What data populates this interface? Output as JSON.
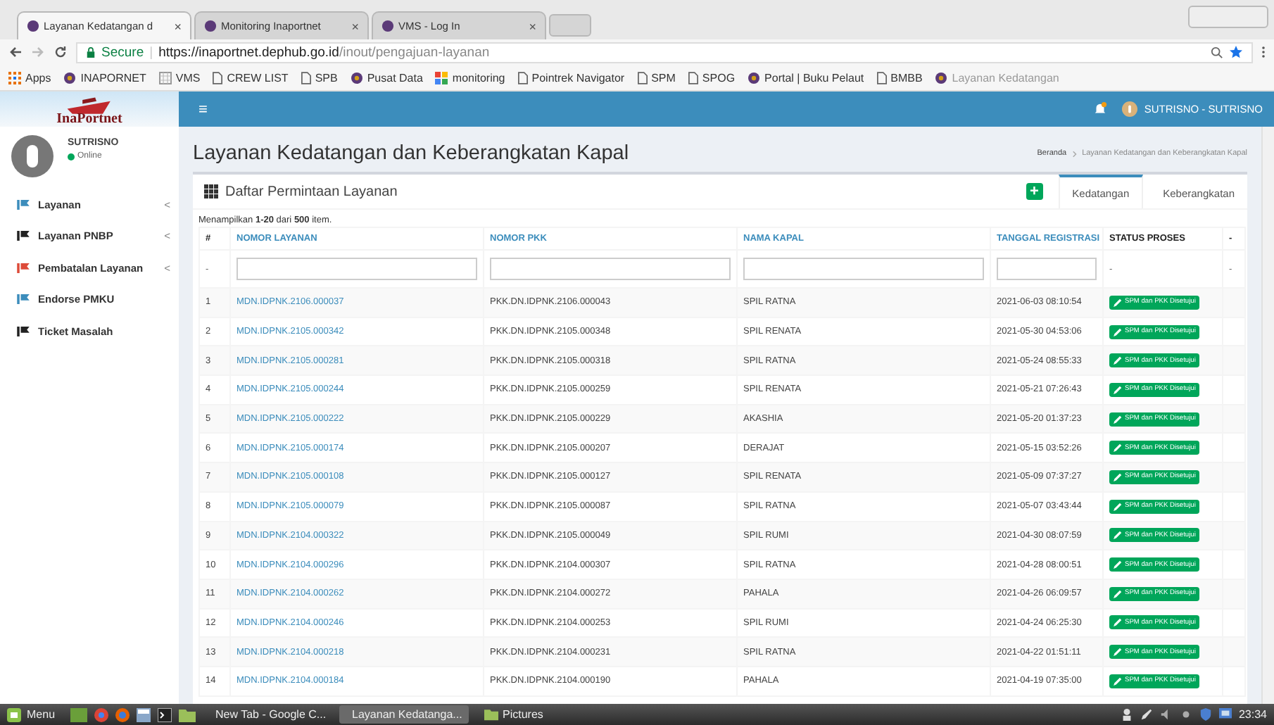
{
  "browser": {
    "tabs": [
      {
        "title": "Layanan Kedatangan d",
        "selected": true,
        "close": "×"
      },
      {
        "title": "Monitoring Inaportnet",
        "selected": false,
        "close": "×"
      },
      {
        "title": "VMS - Log In",
        "selected": false,
        "close": "×"
      }
    ],
    "secure_label": "Secure",
    "separator": "|",
    "url_host": "https://inaportnet.dephub.go.id",
    "url_path": "/inout/pengajuan-layanan",
    "bookmarks": [
      {
        "label": "Apps",
        "kind": "apps"
      },
      {
        "label": "INAPORNET",
        "kind": "site"
      },
      {
        "label": "VMS",
        "kind": "grid"
      },
      {
        "label": "CREW LIST",
        "kind": "page"
      },
      {
        "label": "SPB",
        "kind": "page"
      },
      {
        "label": "Pusat Data",
        "kind": "site"
      },
      {
        "label": "monitoring",
        "kind": "tiles"
      },
      {
        "label": "Pointrek Navigator",
        "kind": "page"
      },
      {
        "label": "SPM",
        "kind": "page"
      },
      {
        "label": "SPOG",
        "kind": "page"
      },
      {
        "label": "Portal | Buku Pelaut",
        "kind": "site"
      },
      {
        "label": "BMBB",
        "kind": "page"
      },
      {
        "label": "Layanan Kedatangan",
        "kind": "site"
      }
    ]
  },
  "header": {
    "logo": "InaPortnet",
    "menu": "≡",
    "user": "SUTRISNO - SUTRISNO"
  },
  "sidebar": {
    "user": {
      "name": "SUTRISNO",
      "status": "Online"
    },
    "items": [
      {
        "label": "Layanan",
        "color": "#3c8dbc",
        "arrow": "<"
      },
      {
        "label": "Layanan PNBP",
        "color": "#222222",
        "arrow": "<"
      },
      {
        "label": "Pembatalan Layanan",
        "color": "#dd4b39",
        "arrow": "<"
      },
      {
        "label": "Endorse PMKU",
        "color": "#3c8dbc"
      },
      {
        "label": "Ticket Masalah",
        "color": "#222222"
      }
    ]
  },
  "page": {
    "title": "Layanan Kedatangan dan Keberangkatan Kapal",
    "breadcrumb": [
      "Beranda",
      "Layanan Kedatangan dan Keberangkatan Kapal"
    ]
  },
  "box": {
    "title": "Daftar Permintaan Layanan",
    "add": "+",
    "tabs": [
      {
        "label": "Kedatangan",
        "selected": true
      },
      {
        "label": "Keberangkatan",
        "selected": false
      }
    ],
    "summary": "Menampilkan **1-20** dari **500** item."
  },
  "table": {
    "columns": [
      {
        "label": "#",
        "sortable": false
      },
      {
        "label": "NOMOR LAYANAN",
        "sortable": true
      },
      {
        "label": "NOMOR PKK",
        "sortable": true
      },
      {
        "label": "NAMA KAPAL",
        "sortable": true
      },
      {
        "label": "TANGGAL REGISTRASI",
        "sortable": true
      },
      {
        "label": "STATUS PROSES",
        "sortable": false
      },
      {
        "label": "-",
        "sortable": false
      }
    ],
    "filters": [
      {
        "kind": "text",
        "value": "-"
      },
      {
        "kind": "input"
      },
      {
        "kind": "input"
      },
      {
        "kind": "input"
      },
      {
        "kind": "input"
      },
      {
        "kind": "text",
        "value": "-"
      },
      {
        "kind": "text",
        "value": "-"
      }
    ],
    "rows": [
      {
        "no": "1",
        "nomor_layanan": "MDN.IDPNK.2106.000037",
        "nomor_pkk": "PKK.DN.IDPNK.2106.000043",
        "nama_kapal": "SPIL RATNA",
        "tanggal": "2021-06-03 08:10:54",
        "status": "SPM dan PKK Disetujui"
      },
      {
        "no": "2",
        "nomor_layanan": "MDN.IDPNK.2105.000342",
        "nomor_pkk": "PKK.DN.IDPNK.2105.000348",
        "nama_kapal": "SPIL RENATA",
        "tanggal": "2021-05-30 04:53:06",
        "status": "SPM dan PKK Disetujui"
      },
      {
        "no": "3",
        "nomor_layanan": "MDN.IDPNK.2105.000281",
        "nomor_pkk": "PKK.DN.IDPNK.2105.000318",
        "nama_kapal": "SPIL RATNA",
        "tanggal": "2021-05-24 08:55:33",
        "status": "SPM dan PKK Disetujui"
      },
      {
        "no": "4",
        "nomor_layanan": "MDN.IDPNK.2105.000244",
        "nomor_pkk": "PKK.DN.IDPNK.2105.000259",
        "nama_kapal": "SPIL RENATA",
        "tanggal": "2021-05-21 07:26:43",
        "status": "SPM dan PKK Disetujui"
      },
      {
        "no": "5",
        "nomor_layanan": "MDN.IDPNK.2105.000222",
        "nomor_pkk": "PKK.DN.IDPNK.2105.000229",
        "nama_kapal": "AKASHIA",
        "tanggal": "2021-05-20 01:37:23",
        "status": "SPM dan PKK Disetujui"
      },
      {
        "no": "6",
        "nomor_layanan": "MDN.IDPNK.2105.000174",
        "nomor_pkk": "PKK.DN.IDPNK.2105.000207",
        "nama_kapal": "DERAJAT",
        "tanggal": "2021-05-15 03:52:26",
        "status": "SPM dan PKK Disetujui"
      },
      {
        "no": "7",
        "nomor_layanan": "MDN.IDPNK.2105.000108",
        "nomor_pkk": "PKK.DN.IDPNK.2105.000127",
        "nama_kapal": "SPIL RENATA",
        "tanggal": "2021-05-09 07:37:27",
        "status": "SPM dan PKK Disetujui"
      },
      {
        "no": "8",
        "nomor_layanan": "MDN.IDPNK.2105.000079",
        "nomor_pkk": "PKK.DN.IDPNK.2105.000087",
        "nama_kapal": "SPIL RATNA",
        "tanggal": "2021-05-07 03:43:44",
        "status": "SPM dan PKK Disetujui"
      },
      {
        "no": "9",
        "nomor_layanan": "MDN.IDPNK.2104.000322",
        "nomor_pkk": "PKK.DN.IDPNK.2105.000049",
        "nama_kapal": "SPIL RUMI",
        "tanggal": "2021-04-30 08:07:59",
        "status": "SPM dan PKK Disetujui"
      },
      {
        "no": "10",
        "nomor_layanan": "MDN.IDPNK.2104.000296",
        "nomor_pkk": "PKK.DN.IDPNK.2104.000307",
        "nama_kapal": "SPIL RATNA",
        "tanggal": "2021-04-28 08:00:51",
        "status": "SPM dan PKK Disetujui"
      },
      {
        "no": "11",
        "nomor_layanan": "MDN.IDPNK.2104.000262",
        "nomor_pkk": "PKK.DN.IDPNK.2104.000272",
        "nama_kapal": "PAHALA",
        "tanggal": "2021-04-26 06:09:57",
        "status": "SPM dan PKK Disetujui"
      },
      {
        "no": "12",
        "nomor_layanan": "MDN.IDPNK.2104.000246",
        "nomor_pkk": "PKK.DN.IDPNK.2104.000253",
        "nama_kapal": "SPIL RUMI",
        "tanggal": "2021-04-24 06:25:30",
        "status": "SPM dan PKK Disetujui"
      },
      {
        "no": "13",
        "nomor_layanan": "MDN.IDPNK.2104.000218",
        "nomor_pkk": "PKK.DN.IDPNK.2104.000231",
        "nama_kapal": "SPIL RATNA",
        "tanggal": "2021-04-22 01:51:11",
        "status": "SPM dan PKK Disetujui"
      },
      {
        "no": "14",
        "nomor_layanan": "MDN.IDPNK.2104.000184",
        "nomor_pkk": "PKK.DN.IDPNK.2104.000190",
        "nama_kapal": "PAHALA",
        "tanggal": "2021-04-19 07:35:00",
        "status": "SPM dan PKK Disetujui"
      }
    ]
  },
  "taskbar": {
    "menu": "Menu",
    "windows": [
      {
        "title": "New Tab - Google C...",
        "kind": "browser",
        "selected": false
      },
      {
        "title": "Layanan Kedatanga...",
        "kind": "browser",
        "selected": true
      },
      {
        "title": "Pictures",
        "kind": "folder",
        "selected": false
      }
    ],
    "clock": "23:34"
  }
}
